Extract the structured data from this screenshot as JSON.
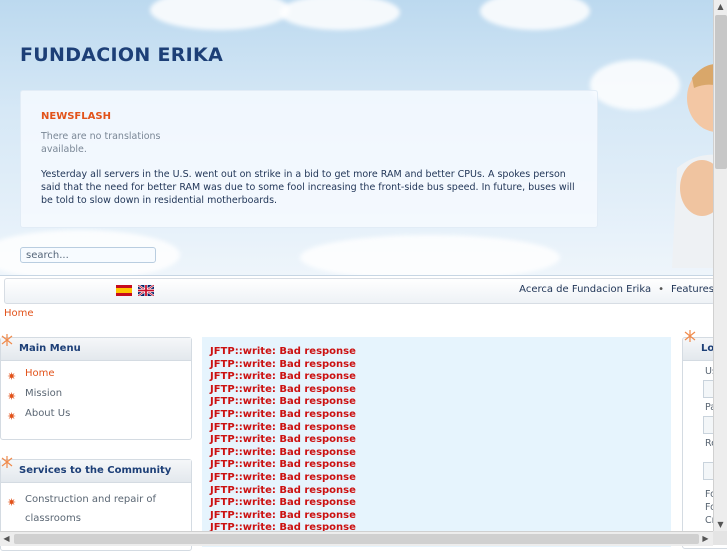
{
  "header": {
    "site_title": "FUNDACION ERIKA",
    "newsflash_title": "NEWSFLASH",
    "no_translations": "There are no translations available.",
    "newsflash_text": "Yesterday all servers in the U.S. went out on strike in a bid to get more RAM and better CPUs. A spokes person said that the need for better RAM was due to some fool increasing the front-side bus speed. In future, buses will be told to slow down in residential motherboards.",
    "search_placeholder": "search..."
  },
  "nav": {
    "links": [
      "Acerca de Fundacion Erika",
      "Features"
    ],
    "separator": "•"
  },
  "breadcrumb": "Home",
  "main_menu": {
    "title": "Main Menu",
    "items": [
      "Home",
      "Mission",
      "About Us"
    ]
  },
  "services_menu": {
    "title": "Services to the Community",
    "items": [
      "Construction and repair of classrooms"
    ]
  },
  "content": {
    "error_line": "JFTP::write: Bad response",
    "visible_line_count": 15
  },
  "login_module": {
    "title_partial": "Lo",
    "field_labels": [
      "Us",
      "Pa",
      "Re"
    ],
    "footer_fragments": [
      "Fo",
      "Fo",
      "Cr"
    ]
  },
  "colors": {
    "accent": "#e2531b",
    "title_blue": "#1d3f77",
    "error_red": "#cc1111",
    "content_bg": "#e6f4fd"
  },
  "icons": [
    "flag-spain-icon",
    "flag-uk-icon",
    "spark-icon",
    "star-bullet-icon",
    "scroll-arrow-icon"
  ]
}
